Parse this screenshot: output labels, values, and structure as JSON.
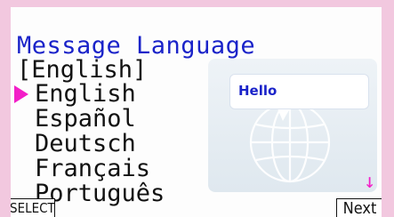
{
  "screen": {
    "title": "Message Language",
    "current_language": "[English]",
    "languages": [
      "English",
      "Español",
      "Deutsch",
      "Français",
      "Português"
    ],
    "selected_index": 0,
    "bubble_text": "Hello",
    "softkeys": {
      "select": "SELECT",
      "next": "Next"
    },
    "icons": {
      "cursor": "right-pointing-triangle",
      "scroll": "down-arrow",
      "illustration": "globe-with-speech-bubble"
    },
    "colors": {
      "title": "#1a23c9",
      "accent": "#f31ec8",
      "frame": "#f2c8df"
    }
  }
}
